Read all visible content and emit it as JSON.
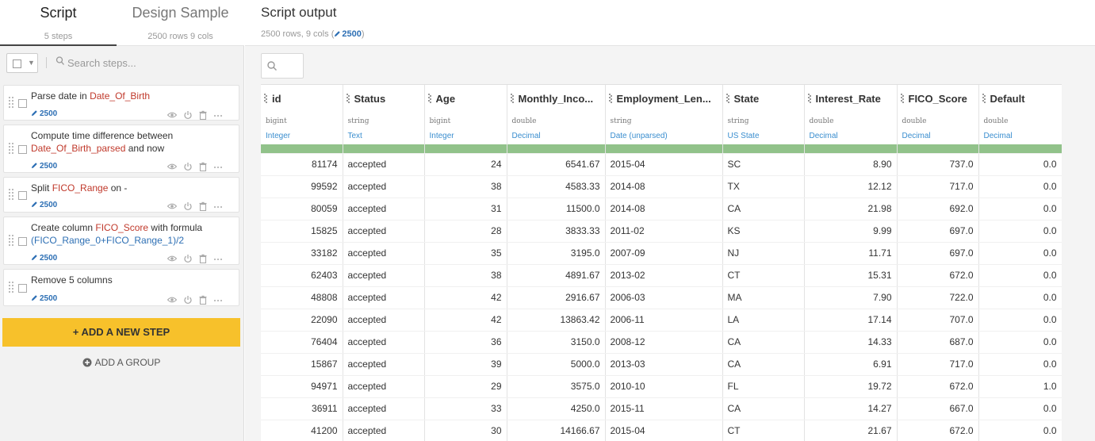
{
  "tabs": {
    "script": {
      "label": "Script",
      "sub": "5 steps"
    },
    "design": {
      "label": "Design Sample",
      "sub": "2500 rows 9 cols"
    }
  },
  "steps_toolbar": {
    "search_placeholder": "Search steps..."
  },
  "steps": [
    {
      "badge": "2500",
      "parts": [
        {
          "t": "Parse date ",
          "c": ""
        },
        {
          "t": "in ",
          "c": ""
        },
        {
          "t": "Date_Of_Birth",
          "c": "hl"
        }
      ]
    },
    {
      "badge": "2500",
      "parts": [
        {
          "t": "Compute time difference between ",
          "c": ""
        },
        {
          "t": "Date_Of_Birth_parsed",
          "c": "hl"
        },
        {
          "t": " and now",
          "c": ""
        }
      ]
    },
    {
      "badge": "2500",
      "parts": [
        {
          "t": "Split ",
          "c": ""
        },
        {
          "t": "FICO_Range",
          "c": "hl"
        },
        {
          "t": " on -",
          "c": ""
        }
      ]
    },
    {
      "badge": "2500",
      "parts": [
        {
          "t": "Create column ",
          "c": ""
        },
        {
          "t": "FICO_Score",
          "c": "hl"
        },
        {
          "t": " with formula ",
          "c": ""
        },
        {
          "t": "(FICO_Range_0+FICO_Range_1)/2",
          "c": "hlb"
        }
      ]
    },
    {
      "badge": "2500",
      "parts": [
        {
          "t": "Remove 5 columns",
          "c": ""
        }
      ]
    }
  ],
  "actions": {
    "add_step": "+ ADD A NEW STEP",
    "add_group": "ADD A GROUP"
  },
  "output": {
    "title": "Script output",
    "rows": "2500 rows,",
    "cols": "9 cols",
    "paren_open": "(",
    "badge": "2500",
    "paren_close": ")"
  },
  "columns": [
    {
      "name": "id",
      "storage": "bigint",
      "meaning": "Integer",
      "align": "num"
    },
    {
      "name": "Status",
      "storage": "string",
      "meaning": "Text",
      "align": "txt"
    },
    {
      "name": "Age",
      "storage": "bigint",
      "meaning": "Integer",
      "align": "num"
    },
    {
      "name": "Monthly_Inco...",
      "storage": "double",
      "meaning": "Decimal",
      "align": "num"
    },
    {
      "name": "Employment_Len...",
      "storage": "string",
      "meaning": "Date (unparsed)",
      "align": "txt"
    },
    {
      "name": "State",
      "storage": "string",
      "meaning": "US State",
      "align": "txt"
    },
    {
      "name": "Interest_Rate",
      "storage": "double",
      "meaning": "Decimal",
      "align": "num"
    },
    {
      "name": "FICO_Score",
      "storage": "double",
      "meaning": "Decimal",
      "align": "num"
    },
    {
      "name": "Default",
      "storage": "double",
      "meaning": "Decimal",
      "align": "num"
    }
  ],
  "rows": [
    [
      "81174",
      "accepted",
      "24",
      "6541.67",
      "2015-04",
      "SC",
      "8.90",
      "737.0",
      "0.0"
    ],
    [
      "99592",
      "accepted",
      "38",
      "4583.33",
      "2014-08",
      "TX",
      "12.12",
      "717.0",
      "0.0"
    ],
    [
      "80059",
      "accepted",
      "31",
      "11500.0",
      "2014-08",
      "CA",
      "21.98",
      "692.0",
      "0.0"
    ],
    [
      "15825",
      "accepted",
      "28",
      "3833.33",
      "2011-02",
      "KS",
      "9.99",
      "697.0",
      "0.0"
    ],
    [
      "33182",
      "accepted",
      "35",
      "3195.0",
      "2007-09",
      "NJ",
      "11.71",
      "697.0",
      "0.0"
    ],
    [
      "62403",
      "accepted",
      "38",
      "4891.67",
      "2013-02",
      "CT",
      "15.31",
      "672.0",
      "0.0"
    ],
    [
      "48808",
      "accepted",
      "42",
      "2916.67",
      "2006-03",
      "MA",
      "7.90",
      "722.0",
      "0.0"
    ],
    [
      "22090",
      "accepted",
      "42",
      "13863.42",
      "2006-11",
      "LA",
      "17.14",
      "707.0",
      "0.0"
    ],
    [
      "76404",
      "accepted",
      "36",
      "3150.0",
      "2008-12",
      "CA",
      "14.33",
      "687.0",
      "0.0"
    ],
    [
      "15867",
      "accepted",
      "39",
      "5000.0",
      "2013-03",
      "CA",
      "6.91",
      "717.0",
      "0.0"
    ],
    [
      "94971",
      "accepted",
      "29",
      "3575.0",
      "2010-10",
      "FL",
      "19.72",
      "672.0",
      "1.0"
    ],
    [
      "36911",
      "accepted",
      "33",
      "4250.0",
      "2015-11",
      "CA",
      "14.27",
      "667.0",
      "0.0"
    ],
    [
      "41200",
      "accepted",
      "30",
      "14166.67",
      "2015-04",
      "CT",
      "21.67",
      "672.0",
      "0.0"
    ]
  ]
}
